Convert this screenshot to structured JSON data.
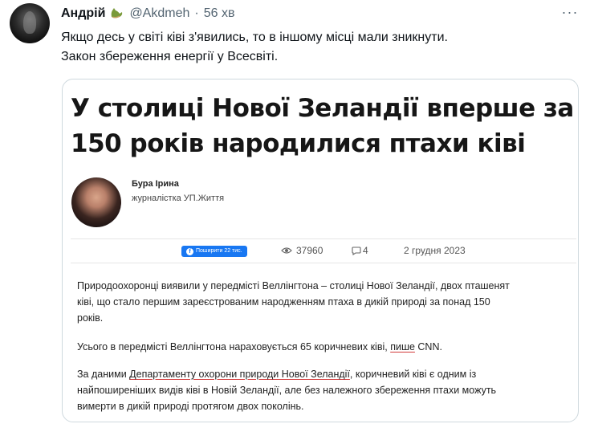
{
  "tweet": {
    "author": "Андрій",
    "handle": "@Akdmeh",
    "separator": "·",
    "time": "56 хв",
    "more": "···",
    "lines": [
      "Якщо десь у світі ківі з'явились, то в іншому місці мали зникнути.",
      "Закон збереження енергії у Всесвіті."
    ]
  },
  "article": {
    "headline_lines": [
      "У столиці Нової Зеландії вперше за",
      "150 років народилися птахи ківі"
    ],
    "journalist_name": "Бура Ірина",
    "journalist_role": "журналістка УП.Життя",
    "share_label": "Поширити 22 тис.",
    "views": "37960",
    "comments": "4",
    "date": "2 грудня 2023",
    "p1_lines": [
      "Природоохоронці виявили у передмісті Веллінгтона – столиці Нової Зеландії, двох пташенят",
      "ківі, що стало першим зареєстрованим народженням птаха в дикій природі за понад 150",
      "років."
    ],
    "p2_prefix": "Усього в передмісті Веллінгтона нараховується 65 коричневих ківі, ",
    "p2_link": "пише",
    "p2_suffix": " CNN.",
    "p3_line1_prefix": "За даними ",
    "p3_link": "Департаменту охорони природи Нової Зеландії",
    "p3_line1_suffix": ", коричневий ківі є одним із",
    "p3_lines_rest": [
      "найпоширеніших видів ківі в Новій Зеландії, але без належного збереження птахи можуть",
      "вимерти в дикій природі протягом двох поколінь."
    ]
  },
  "colors": {
    "accent": "#1877f2",
    "muted": "#536471",
    "link_underline": "#d23a3a"
  },
  "icons": {
    "badge": "duck-emoji-icon",
    "views": "eye-icon",
    "comments": "comment-icon",
    "share": "facebook-icon"
  }
}
